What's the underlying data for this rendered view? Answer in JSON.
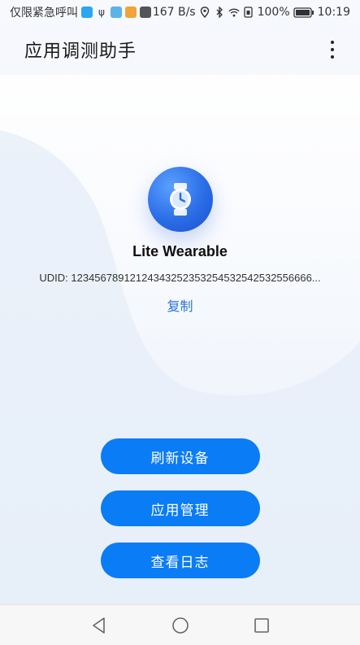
{
  "status_bar": {
    "carrier_text": "仅限紧急呼叫",
    "net_speed": "167 B/s",
    "battery_percent": "100%",
    "time": "10:19"
  },
  "app_bar": {
    "title": "应用调测助手",
    "more_icon": "more-vertical-icon"
  },
  "device": {
    "icon": "watch-icon",
    "name": "Lite Wearable",
    "udid_label": "UDID:",
    "udid_value": "12345678912124343252353254532542532556666...",
    "copy_label": "复制"
  },
  "actions": {
    "refresh_label": "刷新设备",
    "app_manage_label": "应用管理",
    "view_logs_label": "查看日志"
  },
  "nav_bar": {
    "back_icon": "back-triangle-icon",
    "home_icon": "home-circle-icon",
    "recents_icon": "recents-square-icon"
  },
  "colors": {
    "accent": "#0a7cf5",
    "link": "#2b74d8",
    "icon_blue": "#2b6de6"
  }
}
